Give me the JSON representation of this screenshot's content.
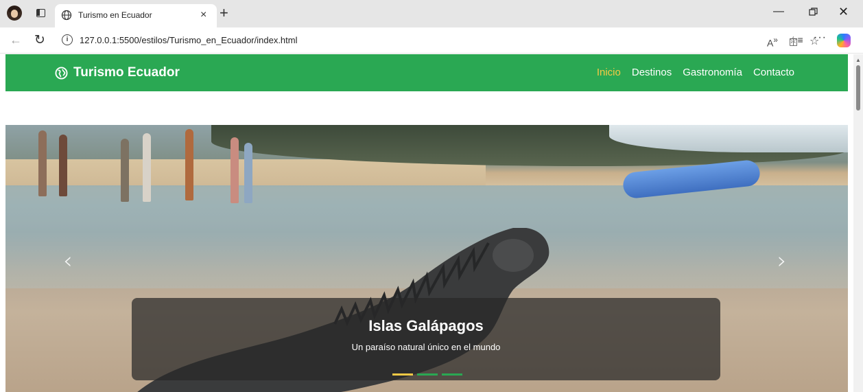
{
  "browser": {
    "tab_title": "Turismo en Ecuador",
    "url": "127.0.0.1:5500/estilos/Turismo_en_Ecuador/index.html",
    "icons": [
      "profile-avatar",
      "tab-actions-icon",
      "globe-icon",
      "close-icon",
      "new-tab-icon",
      "minimize-icon",
      "restore-icon",
      "window-close-icon",
      "back-icon",
      "reload-icon",
      "info-icon",
      "read-aloud-icon",
      "split-screen-icon",
      "favorite-icon",
      "favorites-icon",
      "more-icon",
      "copilot-icon"
    ]
  },
  "site": {
    "brand": "Turismo Ecuador",
    "menu": [
      {
        "label": "Inicio",
        "active": true
      },
      {
        "label": "Destinos",
        "active": false
      },
      {
        "label": "Gastronomía",
        "active": false
      },
      {
        "label": "Contacto",
        "active": false
      }
    ],
    "colors": {
      "primary": "#2aa853",
      "accent": "#f6c945"
    }
  },
  "carousel": {
    "title": "Islas Galápagos",
    "subtitle": "Un paraíso natural único en el mundo",
    "slide_count": 3,
    "active_slide": 1
  }
}
